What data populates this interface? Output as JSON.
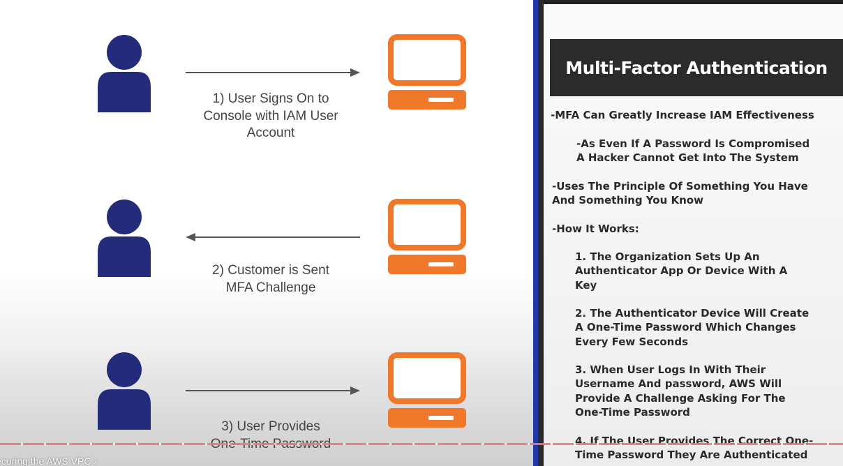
{
  "diagram": {
    "steps": [
      {
        "caption": "1) User Signs On to\nConsole with IAM User\nAccount",
        "direction": "right"
      },
      {
        "caption": "2) Customer is Sent\nMFA Challenge",
        "direction": "left"
      },
      {
        "caption": "3) User Provides\nOne-Time Password",
        "direction": "right"
      }
    ],
    "colors": {
      "person": "#232b7a",
      "monitor": "#f0782a",
      "arrow": "#555555"
    }
  },
  "notes": {
    "title": "Multi-Factor Authentication",
    "lines": [
      "-MFA Can Greatly Increase IAM Effectiveness",
      "-As Even If A Password Is Compromised\n  A Hacker Cannot Get Into The System",
      "-Uses The Principle Of Something You Have\n   And Something You Know",
      "-How It Works:",
      "1. The Organization Sets Up An\n    Authenticator App Or Device With A\n    Key",
      "2. The Authenticator Device Will Create\n    A One-Time Password Which Changes\n    Every Few Seconds",
      "3. When User Logs In With Their\n    Username And password, AWS Will\n    Provide A Challenge Asking For The\n    One-Time Password",
      "4. If The User Provides The Correct One-\n    Time Password They Are Authenticated"
    ]
  },
  "video": {
    "chapter_label": "ecuring the AWS VPC",
    "chapter_chevron": "›"
  }
}
